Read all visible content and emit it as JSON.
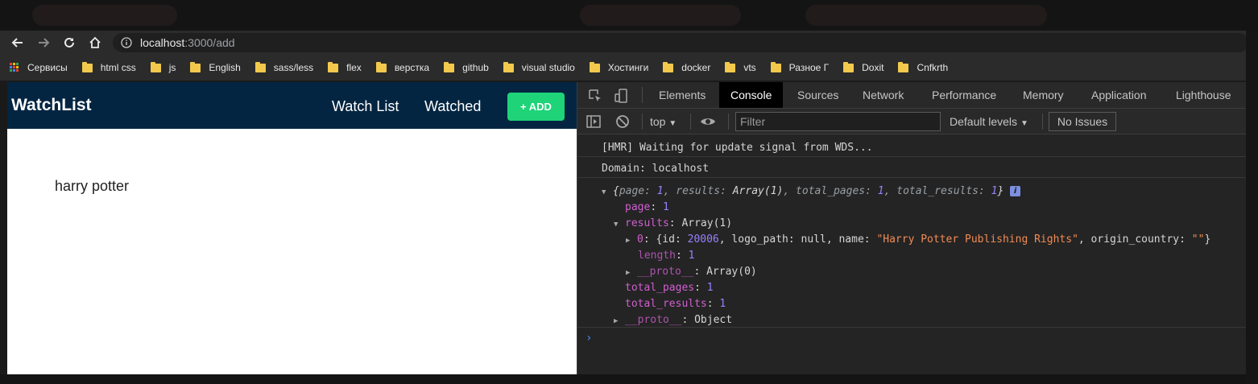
{
  "browser": {
    "url_host": "localhost",
    "url_rest": ":3000/add",
    "bookmarks": [
      {
        "label": "Сервисы",
        "type": "apps"
      },
      {
        "label": "html css",
        "type": "folder"
      },
      {
        "label": "js",
        "type": "folder"
      },
      {
        "label": "English",
        "type": "folder"
      },
      {
        "label": "sass/less",
        "type": "folder"
      },
      {
        "label": "flex",
        "type": "folder"
      },
      {
        "label": "верстка",
        "type": "folder"
      },
      {
        "label": "github",
        "type": "folder"
      },
      {
        "label": "visual studio",
        "type": "folder"
      },
      {
        "label": "Хостинги",
        "type": "folder"
      },
      {
        "label": "docker",
        "type": "folder"
      },
      {
        "label": "vts",
        "type": "folder"
      },
      {
        "label": "Разное Г",
        "type": "folder"
      },
      {
        "label": "Doxit",
        "type": "folder"
      },
      {
        "label": "Cnfkrth",
        "type": "folder"
      }
    ]
  },
  "app": {
    "brand": "WatchList",
    "nav_watchlist": "Watch List",
    "nav_watched": "Watched",
    "add_button": "+ ADD",
    "result_title": "harry potter"
  },
  "devtools": {
    "tabs": [
      "Elements",
      "Console",
      "Sources",
      "Network",
      "Performance",
      "Memory",
      "Application",
      "Lighthouse"
    ],
    "active_tab": "Console",
    "context": "top",
    "filter_placeholder": "Filter",
    "levels": "Default levels",
    "issues": "No Issues",
    "console": {
      "msg1": "[HMR] Waiting for update signal from WDS...",
      "msg2": "Domain: localhost",
      "summary": {
        "open": "{",
        "page_key": "page",
        "page_val": "1",
        "results_key": "results",
        "results_val": "Array(1)",
        "total_pages_key": "total_pages",
        "total_pages_val": "1",
        "total_results_key": "total_results",
        "total_results_val": "1",
        "close": "}"
      },
      "page_key": "page",
      "page_val": "1",
      "results_key": "results",
      "results_type": "Array(1)",
      "item_index": "0",
      "item_open": "{id: ",
      "item_id": "20006",
      "item_logo": ", logo_path: null, name: ",
      "item_name": "\"Harry Potter Publishing Rights\"",
      "item_origin": ", origin_country: ",
      "item_origin_val": "\"\"",
      "item_close": "}",
      "length_key": "length",
      "length_val": "1",
      "proto1_key": "__proto__",
      "proto1_val": "Array(0)",
      "total_pages_key": "total_pages",
      "total_pages_val": "1",
      "total_results_key": "total_results",
      "total_results_val": "1",
      "proto2_key": "__proto__",
      "proto2_val": "Object",
      "prompt": "›"
    }
  },
  "colors": {
    "header_bg": "#032541",
    "add_green": "#1ed378",
    "devtools_bg": "#242424",
    "key_magenta": "#d05fd0",
    "num_purple": "#9980ff",
    "str_orange": "#f28b54"
  }
}
